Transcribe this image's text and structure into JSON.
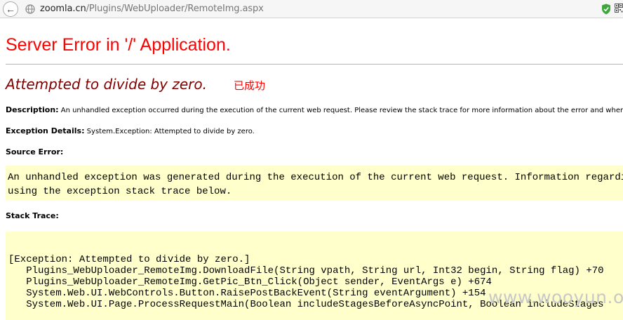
{
  "browser": {
    "url_host": "zoomla.cn",
    "url_path": "/Plugins/WebUploader/RemoteImg.aspx",
    "icons": [
      "back-arrow-icon",
      "globe-icon",
      "shield-check-icon",
      "qr-code-icon"
    ],
    "colors": {
      "shield": "#3fa63f"
    }
  },
  "error": {
    "title": "Server Error in '/' Application.",
    "message": "Attempted to divide by zero.",
    "success_note": "已成功",
    "description_label": "Description:",
    "description_text": "An unhandled exception occurred during the execution of the current web request. Please review the stack trace for more information about the error and where it o",
    "details_label": "Exception Details:",
    "details_text": "System.Exception: Attempted to divide by zero.",
    "source_error_label": "Source Error:",
    "source_lines": [
      "An unhandled exception was generated during the execution of the current web request. Information regarding th",
      "using the exception stack trace below."
    ],
    "stack_trace_label": "Stack Trace:",
    "stack_lines": [
      "[Exception: Attempted to divide by zero.]",
      "   Plugins_WebUploader_RemoteImg.DownloadFile(String vpath, String url, Int32 begin, String flag) +70",
      "   Plugins_WebUploader_RemoteImg.GetPic_Btn_Click(Object sender, EventArgs e) +674",
      "   System.Web.UI.WebControls.Button.RaisePostBackEvent(String eventArgument) +154",
      "   System.Web.UI.Page.ProcessRequestMain(Boolean includeStagesBeforeAsyncPoint, Boolean includeStages"
    ],
    "colors": {
      "title": "#ff0000",
      "message": "#800000",
      "code_bg": "#ffffcc"
    }
  },
  "watermark": "www.wooyun.org"
}
